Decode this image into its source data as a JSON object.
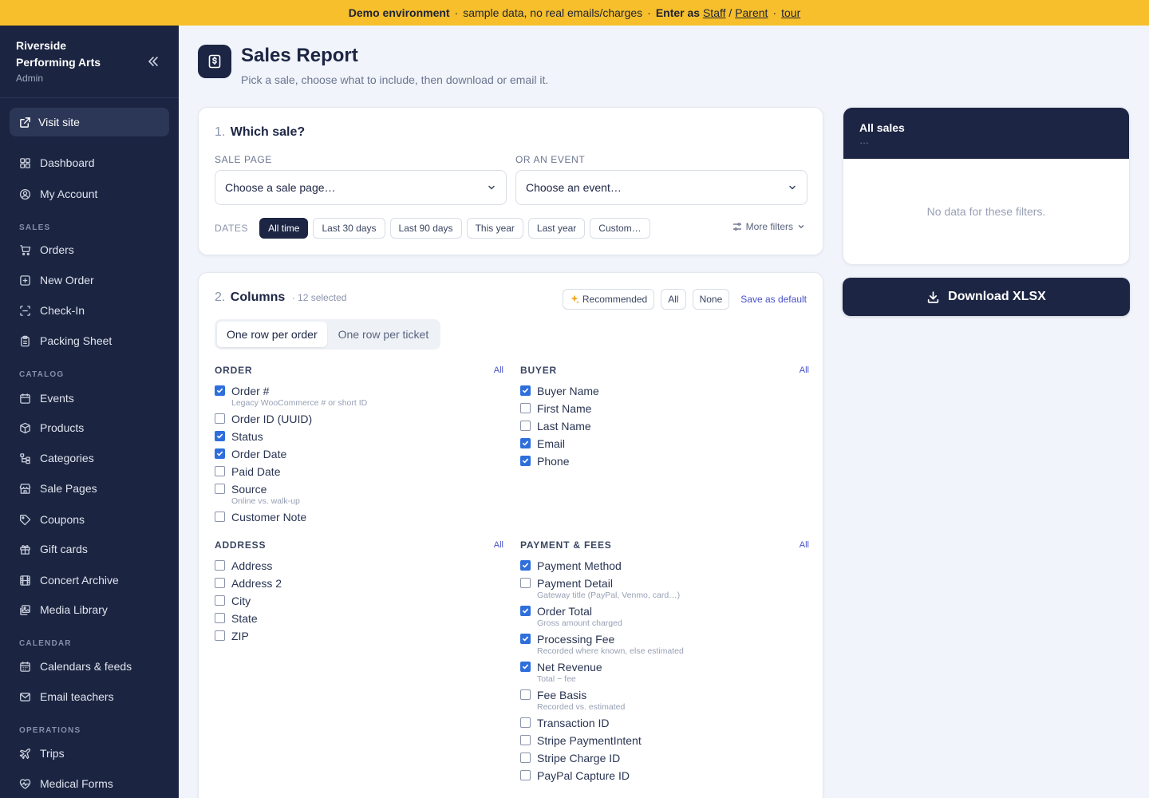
{
  "banner": {
    "env": "Demo environment",
    "note": "sample data, no real emails/charges",
    "enter_as": "Enter as",
    "staff": "Staff",
    "parent": "Parent",
    "tour": "tour",
    "dot": "·",
    "slash": "/"
  },
  "sidebar": {
    "brand_line1": "Riverside",
    "brand_line2": "Performing Arts",
    "role": "Admin",
    "visit_site": "Visit site",
    "items": {
      "dashboard": "Dashboard",
      "my_account": "My Account",
      "orders": "Orders",
      "new_order": "New Order",
      "check_in": "Check-In",
      "packing_sheet": "Packing Sheet",
      "events": "Events",
      "products": "Products",
      "categories": "Categories",
      "sale_pages": "Sale Pages",
      "coupons": "Coupons",
      "gift_cards": "Gift cards",
      "concert_archive": "Concert Archive",
      "media_library": "Media Library",
      "calendars_feeds": "Calendars & feeds",
      "email_teachers": "Email teachers",
      "trips": "Trips",
      "medical_forms": "Medical Forms"
    },
    "sections": {
      "sales": "SALES",
      "catalog": "CATALOG",
      "calendar": "CALENDAR",
      "operations": "OPERATIONS"
    }
  },
  "page": {
    "title": "Sales Report",
    "subtitle": "Pick a sale, choose what to include, then download or email it."
  },
  "which_sale": {
    "num": "1.",
    "title": "Which sale?",
    "sale_page_label": "SALE PAGE",
    "sale_page_placeholder": "Choose a sale page…",
    "event_label": "OR AN EVENT",
    "event_placeholder": "Choose an event…",
    "dates_label": "DATES",
    "date_chips": [
      "All time",
      "Last 30 days",
      "Last 90 days",
      "This year",
      "Last year",
      "Custom…"
    ],
    "active_chip": "All time",
    "more_filters": "More filters"
  },
  "columns": {
    "num": "2.",
    "title": "Columns",
    "count": "· 12 selected",
    "recommended": "Recommended",
    "all": "All",
    "none": "None",
    "save_default": "Save as default",
    "row_modes": [
      "One row per order",
      "One row per ticket"
    ],
    "groups": {
      "order": {
        "title": "ORDER",
        "all": "All",
        "options": [
          {
            "label": "Order #",
            "hint": "Legacy WooCommerce # or short ID",
            "checked": true
          },
          {
            "label": "Order ID (UUID)",
            "hint": "",
            "checked": false
          },
          {
            "label": "Status",
            "hint": "",
            "checked": true
          },
          {
            "label": "Order Date",
            "hint": "",
            "checked": true
          },
          {
            "label": "Paid Date",
            "hint": "",
            "checked": false
          },
          {
            "label": "Source",
            "hint": "Online vs. walk-up",
            "checked": false
          },
          {
            "label": "Customer Note",
            "hint": "",
            "checked": false
          }
        ]
      },
      "buyer": {
        "title": "BUYER",
        "all": "All",
        "options": [
          {
            "label": "Buyer Name",
            "hint": "",
            "checked": true
          },
          {
            "label": "First Name",
            "hint": "",
            "checked": false
          },
          {
            "label": "Last Name",
            "hint": "",
            "checked": false
          },
          {
            "label": "Email",
            "hint": "",
            "checked": true
          },
          {
            "label": "Phone",
            "hint": "",
            "checked": true
          }
        ]
      },
      "address": {
        "title": "ADDRESS",
        "all": "All",
        "options": [
          {
            "label": "Address",
            "hint": "",
            "checked": false
          },
          {
            "label": "Address 2",
            "hint": "",
            "checked": false
          },
          {
            "label": "City",
            "hint": "",
            "checked": false
          },
          {
            "label": "State",
            "hint": "",
            "checked": false
          },
          {
            "label": "ZIP",
            "hint": "",
            "checked": false
          }
        ]
      },
      "payment": {
        "title": "PAYMENT & FEES",
        "all": "All",
        "options": [
          {
            "label": "Payment Method",
            "hint": "",
            "checked": true
          },
          {
            "label": "Payment Detail",
            "hint": "Gateway title (PayPal, Venmo, card…)",
            "checked": false
          },
          {
            "label": "Order Total",
            "hint": "Gross amount charged",
            "checked": true
          },
          {
            "label": "Processing Fee",
            "hint": "Recorded where known, else estimated",
            "checked": true
          },
          {
            "label": "Net Revenue",
            "hint": "Total − fee",
            "checked": true
          },
          {
            "label": "Fee Basis",
            "hint": "Recorded vs. estimated",
            "checked": false
          },
          {
            "label": "Transaction ID",
            "hint": "",
            "checked": false
          },
          {
            "label": "Stripe PaymentIntent",
            "hint": "",
            "checked": false
          },
          {
            "label": "Stripe Charge ID",
            "hint": "",
            "checked": false
          },
          {
            "label": "PayPal Capture ID",
            "hint": "",
            "checked": false
          }
        ]
      }
    }
  },
  "summary": {
    "title": "All sales",
    "sub": "…",
    "empty": "No data for these filters."
  },
  "download": {
    "label": "Download XLSX"
  },
  "colors": {
    "banner": "#f6bf2b",
    "sidebar": "#1b2440",
    "navy": "#1c2543",
    "checkbox": "#2f6fdc",
    "link": "#4751c9"
  }
}
